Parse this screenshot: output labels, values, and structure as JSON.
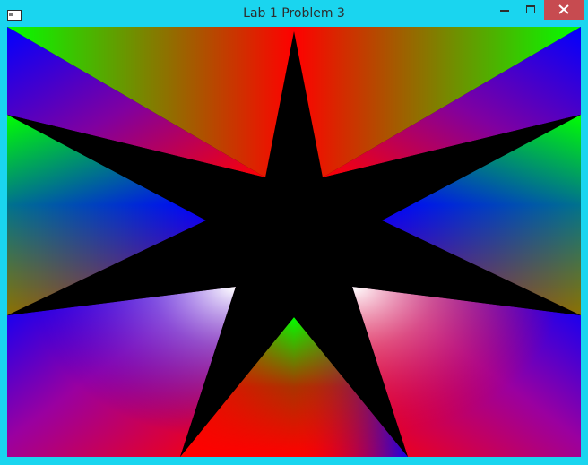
{
  "window": {
    "title": "Lab 1 Problem 3",
    "frame_color": "#1ad5ef",
    "close_button_color": "#c74b50"
  },
  "icons": {
    "app": "window-app-icon",
    "minimize": "minimize-icon",
    "maximize": "maximize-icon",
    "close": "close-icon"
  },
  "canvas": {
    "background": "#000000",
    "palette": {
      "red": "#ff0000",
      "green": "#00ff00",
      "blue": "#0000ff",
      "white": "#ffffff",
      "black": "#000000"
    }
  }
}
